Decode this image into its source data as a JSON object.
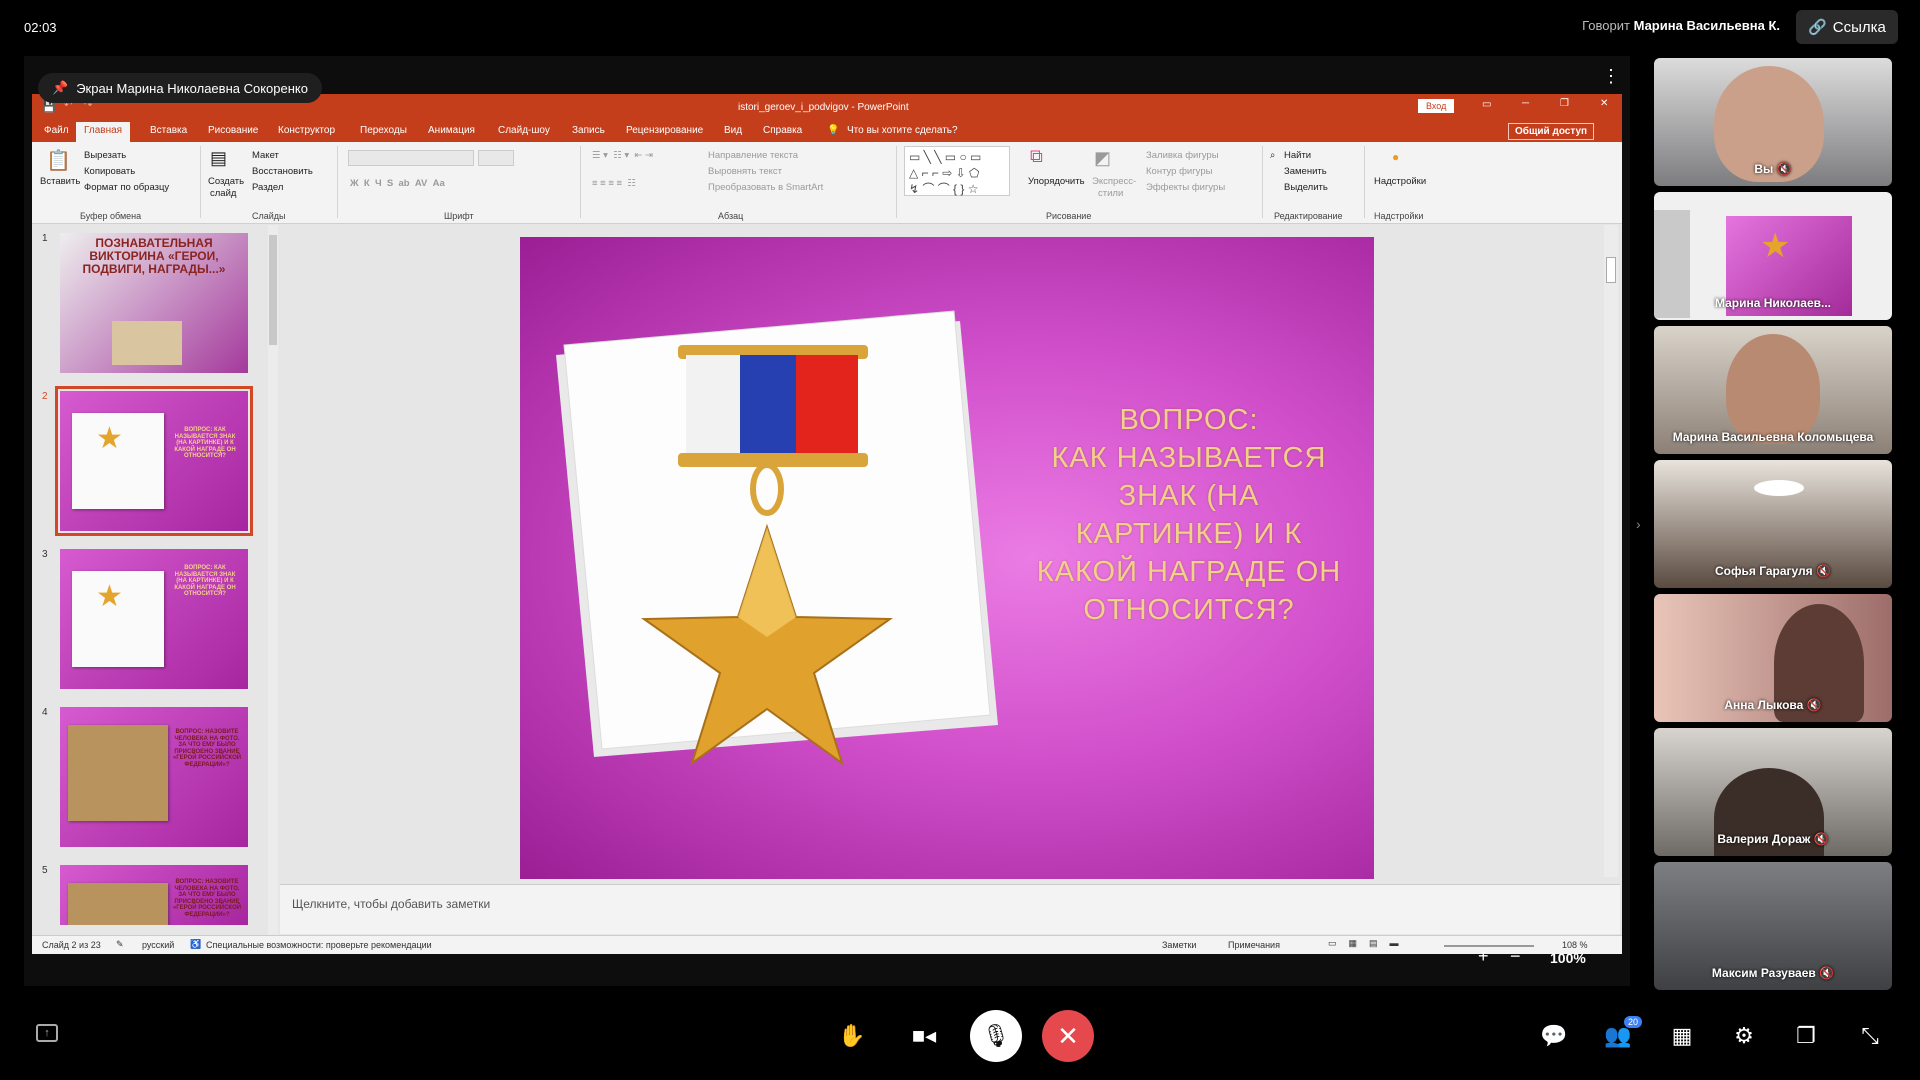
{
  "time": "02:03",
  "speaker": {
    "prefix": "Говорит",
    "name": "Марина Васильевна К."
  },
  "link_button": "Ссылка",
  "screen_tag": "Экран Марина Николаевна Сокоренко",
  "ppt": {
    "window_title": "istori_geroev_i_podvigov - PowerPoint",
    "login": "Вход",
    "tabs": [
      "Файл",
      "Главная",
      "Вставка",
      "Рисование",
      "Конструктор",
      "Переходы",
      "Анимация",
      "Слайд-шоу",
      "Запись",
      "Рецензирование",
      "Вид",
      "Справка"
    ],
    "tell_me": "Что вы хотите сделать?",
    "share": "Общий доступ",
    "ribbon": {
      "paste": "Вставить",
      "cut": "Вырезать",
      "copy": "Копировать",
      "format_painter": "Формат по образцу",
      "clipboard": "Буфер обмена",
      "new_slide_1": "Создать",
      "new_slide_2": "слайд",
      "layout": "Макет",
      "reset": "Восстановить",
      "section": "Раздел",
      "slides": "Слайды",
      "font": "Шрифт",
      "paragraph": "Абзац",
      "text_direction": "Направление текста",
      "align_text": "Выровнять текст",
      "smartart": "Преобразовать в SmartArt",
      "arrange": "Упорядочить",
      "quick_styles_1": "Экспресс-",
      "quick_styles_2": "стили",
      "shape_fill": "Заливка фигуры",
      "shape_outline": "Контур фигуры",
      "shape_effects": "Эффекты фигуры",
      "drawing": "Рисование",
      "find": "Найти",
      "replace": "Заменить",
      "select": "Выделить",
      "editing": "Редактирование",
      "addins": "Надстройки",
      "addins_group": "Надстройки"
    },
    "thumbnails": [
      {
        "num": "1",
        "text": "ПОЗНАВАТЕЛЬНАЯ ВИКТОРИНА «ГЕРОИ, ПОДВИГИ, НАГРАДЫ...»"
      },
      {
        "num": "2",
        "text": "ВОПРОС: КАК НАЗЫВАЕТСЯ ЗНАК (НА КАРТИНКЕ) И К КАКОЙ НАГРАДЕ ОН ОТНОСИТСЯ?"
      },
      {
        "num": "3",
        "text": "ВОПРОС: КАК НАЗЫВАЕТСЯ ЗНАК (НА КАРТИНКЕ) И К КАКОЙ НАГРАДЕ ОН ОТНОСИТСЯ?"
      },
      {
        "num": "4",
        "text": "ВОПРОС: НАЗОВИТЕ ЧЕЛОВЕКА НА ФОТО. ЗА ЧТО ЕМУ БЫЛО ПРИСВОЕНО ЗВАНИЕ «ГЕРОЙ РОССИЙСКОЙ ФЕДЕРАЦИИ»?"
      },
      {
        "num": "5",
        "text": "ВОПРОС: НАЗОВИТЕ ЧЕЛОВЕКА НА ФОТО. ЗА ЧТО ЕМУ БЫЛО ПРИСВОЕНО ЗВАНИЕ «ГЕРОЙ РОССИЙСКОЙ ФЕДЕРАЦИИ»?"
      }
    ],
    "slide_text_lines": [
      "ВОПРОС:",
      "КАК НАЗЫВАЕТСЯ",
      "ЗНАК (НА",
      "КАРТИНКЕ) И К",
      "КАКОЙ НАГРАДЕ ОН",
      "ОТНОСИТСЯ?"
    ],
    "notes_placeholder": "Щелкните, чтобы добавить заметки",
    "status": {
      "slide": "Слайд 2 из 23",
      "language": "русский",
      "accessibility": "Специальные возможности: проверьте рекомендации",
      "notes": "Заметки",
      "comments": "Примечания",
      "zoom": "108 %"
    }
  },
  "zoom_overlay": "100%",
  "participants": [
    {
      "name": "Вы",
      "muted": true,
      "bg": "#7d7d80"
    },
    {
      "name": "Марина Николаев...",
      "muted": false,
      "bg": "#d050c8"
    },
    {
      "name": "Марина Васильевна Коломыцева",
      "muted": false,
      "bg": "#8c8076"
    },
    {
      "name": "Софья Гарагуля",
      "muted": true,
      "bg": "#5a4a40"
    },
    {
      "name": "Анна Лыкова",
      "muted": true,
      "bg": "#9d6d6a"
    },
    {
      "name": "Валерия Дораж",
      "muted": true,
      "bg": "#6e6a66"
    },
    {
      "name": "Максим Разуваев",
      "muted": true,
      "bg": "#4e4f52"
    }
  ],
  "participants_badge": "20",
  "colors": {
    "ppt_accent": "#c43e1c",
    "end_call": "#e5484d"
  }
}
